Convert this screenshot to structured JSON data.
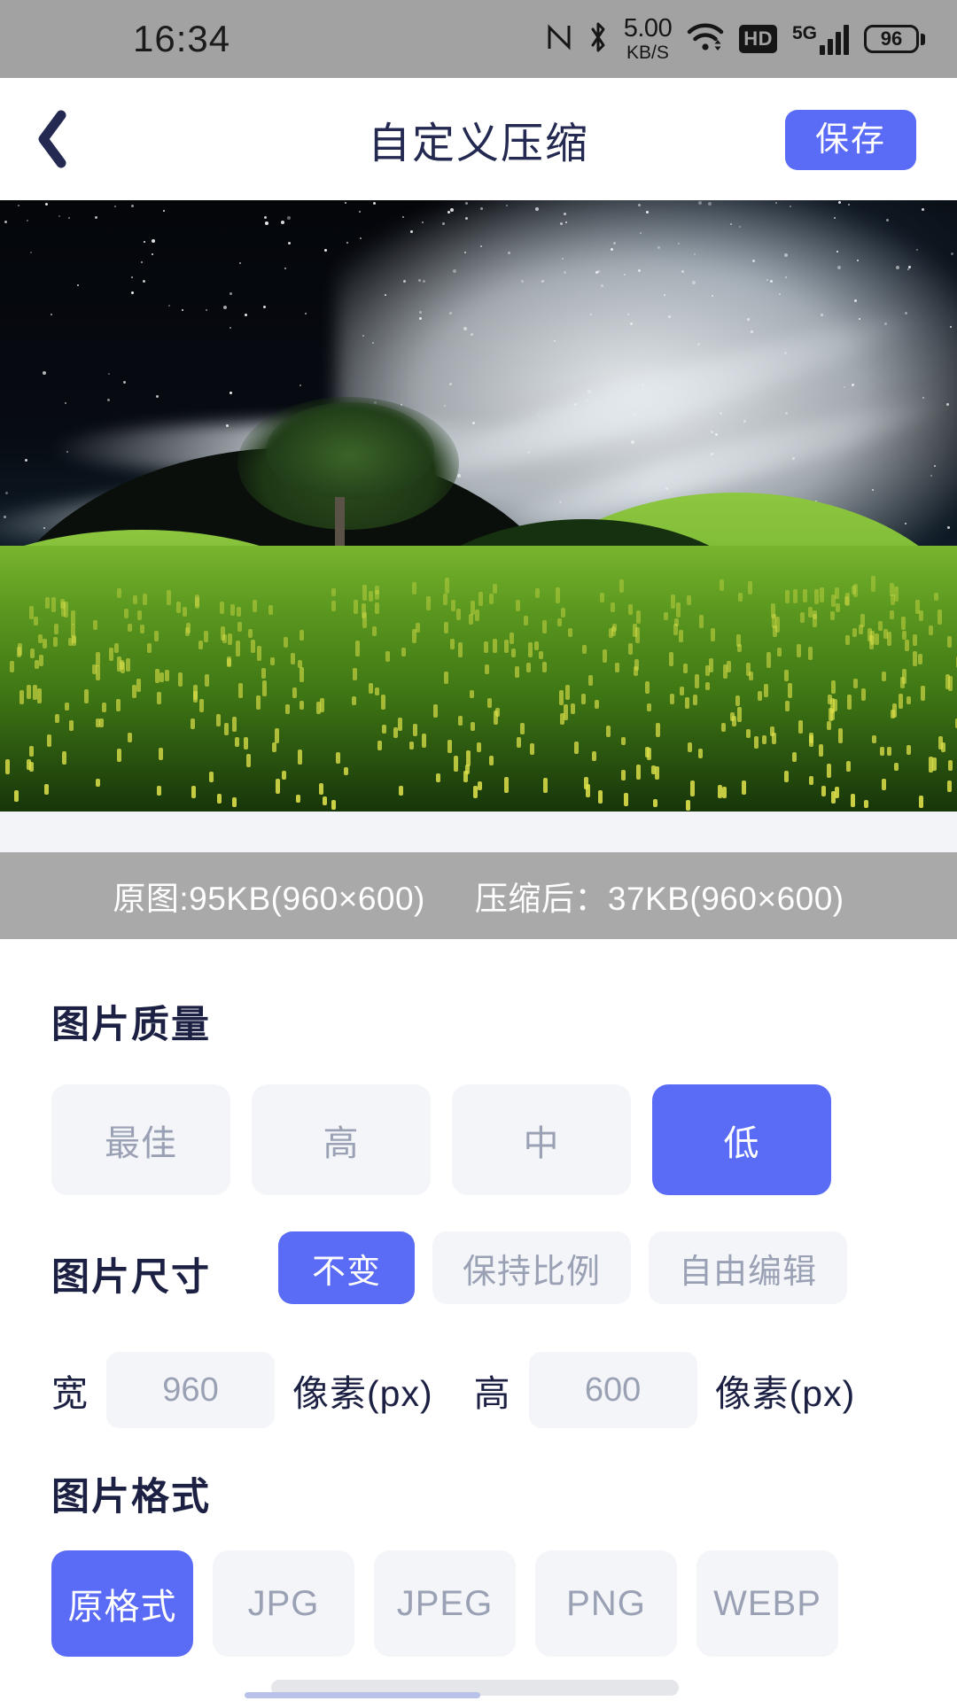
{
  "statusbar": {
    "time": "16:34",
    "nfc_icon": "nfc-icon",
    "bluetooth_icon": "bluetooth-icon",
    "net_speed_value": "5.00",
    "net_speed_unit": "KB/S",
    "wifi_icon": "wifi-icon",
    "hd_label": "HD",
    "network_type": "5G",
    "signal_icon": "signal-bars-icon",
    "battery_level": "96"
  },
  "header": {
    "back_icon": "back-chevron-icon",
    "title": "自定义压缩",
    "save_label": "保存"
  },
  "preview": {
    "alt": "night-sky-meadow-photo"
  },
  "info": {
    "original": "原图:95KB(960×600)",
    "compressed": "压缩后：37KB(960×600)"
  },
  "quality": {
    "title": "图片质量",
    "options": [
      {
        "label": "最佳",
        "selected": false
      },
      {
        "label": "高",
        "selected": false
      },
      {
        "label": "中",
        "selected": false
      },
      {
        "label": "低",
        "selected": true
      }
    ]
  },
  "size": {
    "title": "图片尺寸",
    "options": [
      {
        "label": "不变",
        "selected": true
      },
      {
        "label": "保持比例",
        "selected": false
      },
      {
        "label": "自由编辑",
        "selected": false
      }
    ],
    "width_label": "宽",
    "width_value": "960",
    "width_unit": "像素(px)",
    "height_label": "高",
    "height_value": "600",
    "height_unit": "像素(px)"
  },
  "format": {
    "title": "图片格式",
    "options": [
      {
        "label": "原格式",
        "selected": true
      },
      {
        "label": "JPG",
        "selected": false
      },
      {
        "label": "JPEG",
        "selected": false
      },
      {
        "label": "PNG",
        "selected": false
      },
      {
        "label": "WEBP",
        "selected": false
      }
    ]
  },
  "colors": {
    "accent": "#5a6bf5",
    "chip_bg": "#f3f5f9",
    "chip_text": "#9aa1b4",
    "heading": "#1c2144",
    "statusbar_bg": "#a2a2a2",
    "infobar_bg": "#a9a9a9"
  }
}
